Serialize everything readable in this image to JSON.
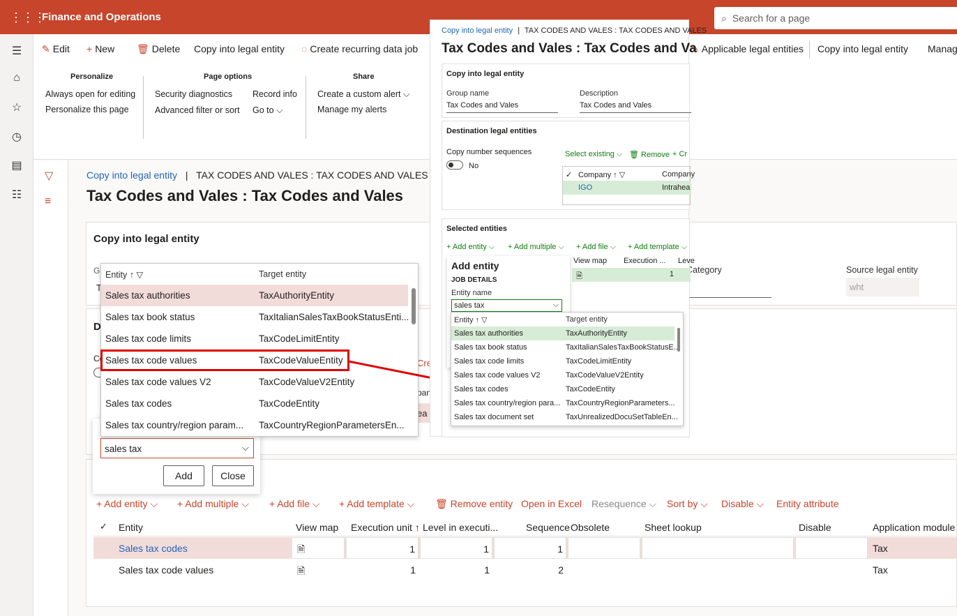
{
  "app": {
    "title": "Finance and Operations",
    "search_placeholder": "Search for a page"
  },
  "commands": [
    {
      "label": "Edit",
      "icon": "pencil-icon"
    },
    {
      "label": "New",
      "icon": "plus-icon"
    },
    {
      "label": "Delete",
      "icon": "trash-icon"
    },
    {
      "label": "Copy into legal entity",
      "icon": ""
    },
    {
      "label": "Create recurring data job",
      "icon": "recurring-icon"
    }
  ],
  "right_commands": {
    "applicable": "Applicable legal entities",
    "copy": "Copy into legal entity",
    "manage": "Manag"
  },
  "groups": {
    "personalize": {
      "title": "Personalize",
      "items": [
        "Always open for editing",
        "Personalize this page"
      ]
    },
    "page_options": {
      "title": "Page options",
      "items": [
        "Security diagnostics",
        "Advanced filter or sort",
        "Record info",
        "Go to"
      ]
    },
    "share": {
      "title": "Share",
      "items": [
        "Create a custom alert",
        "Manage my alerts"
      ]
    }
  },
  "page": {
    "breadcrumb_link": "Copy into legal entity",
    "breadcrumb_sep": "|",
    "breadcrumb_rest": "TAX CODES AND VALES : TAX CODES AND VALES",
    "title": "Tax Codes and Vales : Tax Codes and Vales",
    "card_title": "Copy into legal entity",
    "partial_labels": {
      "gr": "Gr",
      "t": "T",
      "d": "D",
      "co": "Co",
      "cre": "Cre",
      "pany": "pany",
      "ea": "ea"
    }
  },
  "side_fields": {
    "category_label": "Category",
    "category_value": "t",
    "source_label": "Source legal entity",
    "source_value": "wht"
  },
  "dropdown_main": {
    "col1": "Entity",
    "col2": "Target entity",
    "rows": [
      {
        "entity": "Sales tax authorities",
        "target": "TaxAuthorityEntity"
      },
      {
        "entity": "Sales tax book status",
        "target": "TaxItalianSalesTaxBookStatusEnti..."
      },
      {
        "entity": "Sales tax code limits",
        "target": "TaxCodeLimitEntity"
      },
      {
        "entity": "Sales tax code values",
        "target": "TaxCodeValueEntity"
      },
      {
        "entity": "Sales tax code values V2",
        "target": "TaxCodeValueV2Entity"
      },
      {
        "entity": "Sales tax codes",
        "target": "TaxCodeEntity"
      },
      {
        "entity": "Sales tax country/region param...",
        "target": "TaxCountryRegionParametersEn..."
      }
    ],
    "input_value": "sales tax",
    "add_label": "Add",
    "close_label": "Close"
  },
  "entities_toolbar": {
    "add_entity": "Add entity",
    "add_multiple": "Add multiple",
    "add_file": "Add file",
    "add_template": "Add template",
    "remove_entity": "Remove entity",
    "open_excel": "Open in Excel",
    "resequence": "Resequence",
    "sort_by": "Sort by",
    "disable": "Disable",
    "entity_attribute": "Entity attribute"
  },
  "entities_grid": {
    "headers": [
      "Entity",
      "View map",
      "Execution unit",
      "Level in executi...",
      "Sequence",
      "Obsolete",
      "Sheet lookup",
      "Disable",
      "Application module"
    ],
    "rows": [
      {
        "entity": "Sales tax codes",
        "exec": "1",
        "level": "1",
        "seq": "1",
        "module": "Tax"
      },
      {
        "entity": "Sales tax code values",
        "exec": "1",
        "level": "1",
        "seq": "2",
        "module": "Tax"
      }
    ]
  },
  "overlay": {
    "breadcrumb_link": "Copy into legal entity",
    "breadcrumb_rest": "TAX CODES AND VALES : TAX CODES AND VALES",
    "title": "Tax Codes and Vales : Tax Codes and Va",
    "card1_title": "Copy into legal entity",
    "group_label": "Group name",
    "group_value": "Tax Codes and Vales",
    "desc_label": "Description",
    "desc_value": "Tax Codes and Vales",
    "dest_title": "Destination legal entities",
    "copy_seq_label": "Copy number sequences",
    "copy_seq_value": "No",
    "select_existing": "Select existing",
    "remove": "Remove",
    "cr": "Cr",
    "company_col": "Company",
    "company_col2": "Company",
    "company_value": "IGO",
    "company_name": "Intrahea",
    "selected_title": "Selected entities",
    "add_entity": "Add entity",
    "add_multiple": "Add multiple",
    "add_file": "Add file",
    "add_template": "Add template",
    "panel_title": "Add entity",
    "job_details": "JOB DETAILS",
    "entity_name_label": "Entity name",
    "entity_name_value": "sales tax",
    "view_map": "View map",
    "exec_col": "Execution ...",
    "lev_col": "Leve",
    "exec_value": "1",
    "dd_col1": "Entity",
    "dd_col2": "Target entity",
    "dd_rows": [
      {
        "entity": "Sales tax authorities",
        "target": "TaxAuthorityEntity"
      },
      {
        "entity": "Sales tax book status",
        "target": "TaxItalianSalesTaxBookStatusE..."
      },
      {
        "entity": "Sales tax code limits",
        "target": "TaxCodeLimitEntity"
      },
      {
        "entity": "Sales tax code values V2",
        "target": "TaxCodeValueV2Entity"
      },
      {
        "entity": "Sales tax codes",
        "target": "TaxCodeEntity"
      },
      {
        "entity": "Sales tax country/region para...",
        "target": "TaxCountryRegionParameters..."
      },
      {
        "entity": "Sales tax document set",
        "target": "TaxUnrealizedDocuSetTableEn..."
      }
    ]
  },
  "colors": {
    "brand": "#c6452b",
    "link": "#2266b5",
    "highlight_red": "#e00000",
    "selected_pink": "#f2dcda",
    "selected_green": "#d7ecd6"
  }
}
